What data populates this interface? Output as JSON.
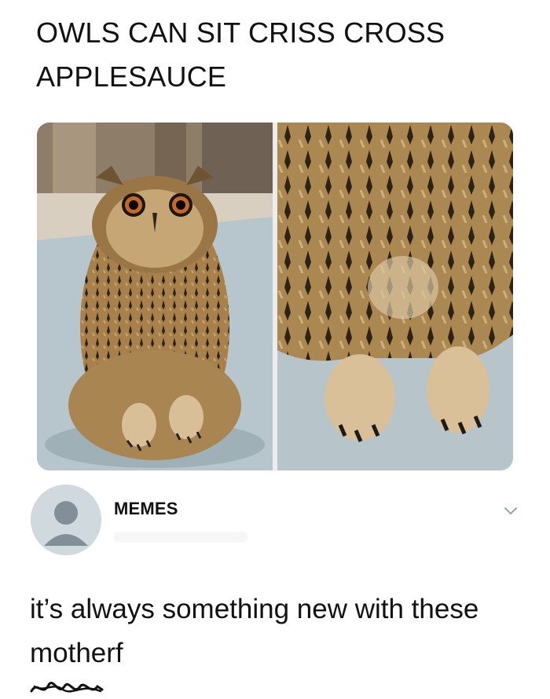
{
  "post": {
    "title_line1": "OWLS CAN SIT CRISS CROSS",
    "title_line2": "APPLESAUCE"
  },
  "media": {
    "left_photo": "owl-full-body-photo",
    "right_photo": "owl-feet-closeup-photo"
  },
  "reply": {
    "author_name": "MEMES",
    "avatar_icon": "default-avatar-icon",
    "menu_icon": "chevron-down-icon",
    "text_line1": "it’s always something new with these",
    "text_line2_visible": "motherf",
    "censor_mark": "scribble-censor-icon"
  },
  "colors": {
    "avatar_bg": "#cfd9de",
    "avatar_fg": "#828f99",
    "text": "#111111",
    "chevron": "#9aa5ae"
  }
}
